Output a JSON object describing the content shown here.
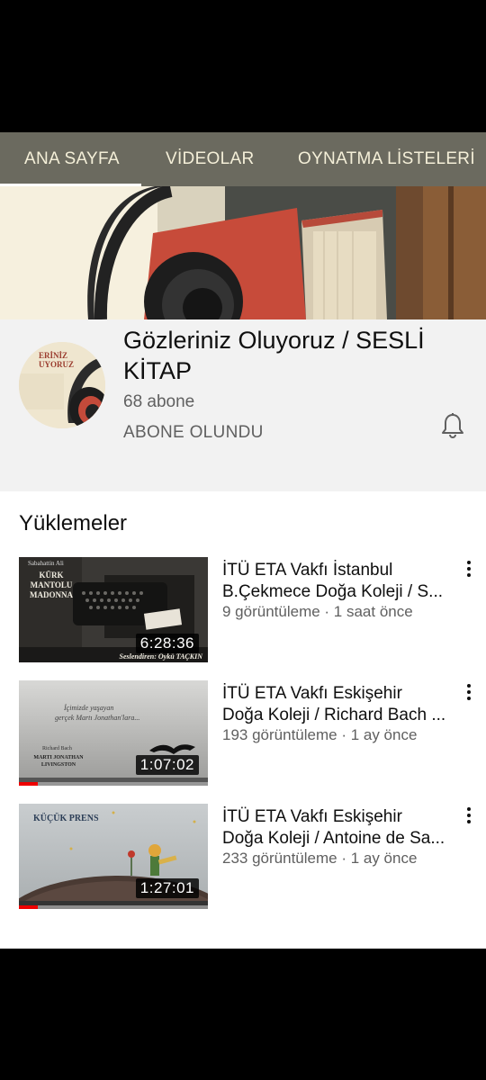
{
  "tabs": [
    {
      "label": "ANA SAYFA",
      "active": true
    },
    {
      "label": "VİDEOLAR",
      "active": false
    },
    {
      "label": "OYNATMA LİSTELERİ",
      "active": false
    }
  ],
  "channel": {
    "name": "Gözleriniz Oluyoruz / SESLİ KİTAP",
    "subscribers": "68 abone",
    "subscribed_label": "ABONE OLUNDU",
    "avatar_text": "ERİNİZ\nUYORUZ"
  },
  "uploads": {
    "title": "Yüklemeler",
    "videos": [
      {
        "title_line1": "İTÜ ETA Vakfı İstanbul",
        "title_line2": "B.Çekmece Doğa Koleji / S...",
        "meta": "9 görüntüleme · 1 saat önce",
        "duration": "6:28:36",
        "progress": 0,
        "thumb": {
          "author": "Sabahattin Ali",
          "book": "KÜRK MANTOLU MADONNA",
          "narrator": "Seslendiren: Öykü TAÇKIN"
        }
      },
      {
        "title_line1": "İTÜ ETA Vakfı Eskişehir",
        "title_line2": "Doğa Koleji / Richard Bach ...",
        "meta": "193 görüntüleme · 1 ay önce",
        "duration": "1:07:02",
        "progress": 0.1,
        "thumb": {
          "quote1": "İçimizde yaşayan",
          "quote2": "gerçek Martı Jonathan'lara...",
          "author": "Richard Bach",
          "book": "MARTI JONATHAN LIVINGSTON"
        }
      },
      {
        "title_line1": "İTÜ ETA Vakfı Eskişehir",
        "title_line2": "Doğa Koleji / Antoine de Sa...",
        "meta": "233 görüntüleme · 1 ay önce",
        "duration": "1:27:01",
        "progress": 0.1,
        "thumb": {
          "book": "KÜÇÜK PRENS"
        }
      }
    ]
  },
  "colors": {
    "tab_bar": "#6b6a5f",
    "tab_text": "#f4efd8",
    "channel_bg": "#f2f2f2",
    "progress": "#e00000"
  },
  "icons": [
    "bell-icon",
    "more-vert-icon"
  ]
}
